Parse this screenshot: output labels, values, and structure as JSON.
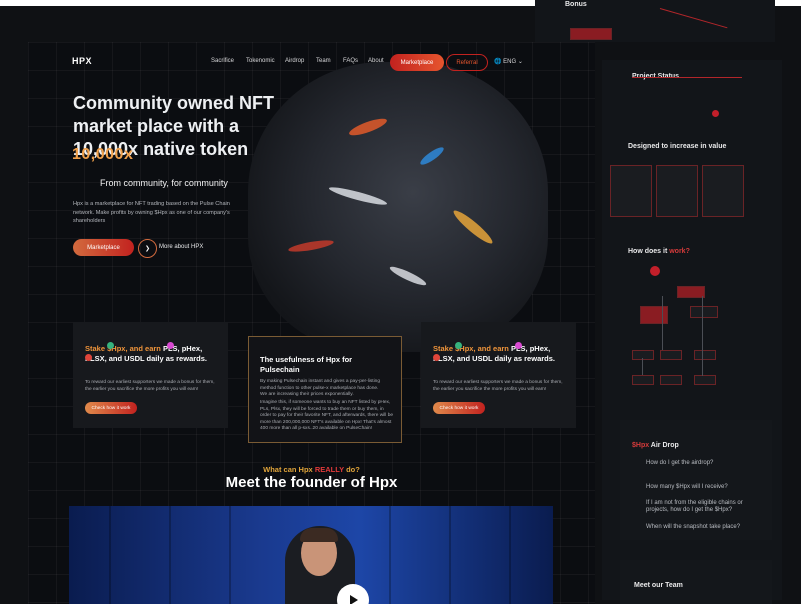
{
  "background_mockups": {
    "bonus_heading": "Bonus",
    "project_status": {
      "title": "Project Status"
    },
    "designed": {
      "title": "Designed to increase in value"
    },
    "how": {
      "title_a": "How does it ",
      "title_b": "work?"
    },
    "airdrop": {
      "title_a": "$Hpx",
      "title_b": " Air Drop",
      "q1": "How do I get the airdrop?",
      "q2": "How many $Hpx will I receive?",
      "q3": "If I am not from the eligible chains or projects, how do I get the $Hpx?",
      "q4": "When will the snapshot take place?"
    },
    "team": {
      "title": "Meet our Team"
    }
  },
  "nav": {
    "logo": "HPX",
    "links": [
      "Sacrifice",
      "Tokenomic",
      "Airdrop",
      "Team",
      "FAQs",
      "About"
    ],
    "marketplace_label": "Marketplace",
    "referral_label": "Referral",
    "language_label": "ENG",
    "globe_icon": "globe-icon",
    "chevron_icon": "chevron-down-icon"
  },
  "hero": {
    "title": "Community owned NFT market place with a 10,000x native token",
    "big_number": "10,000x",
    "subtitle": "From community, for community",
    "description": "Hpx is a marketplace for NFT trading based on the Pulse Chain network. Make profits by owning $Hpx as one of our company's shareholders",
    "cta_primary": "Marketplace",
    "cta_secondary": "More about HPX",
    "cta_secondary_icon": "arrow-right-icon"
  },
  "cards": {
    "left": {
      "title_a": "Stake ",
      "title_b": "$Hpx, and earn",
      "title_c": " PLS, pHex, PLSX, and USDL daily as rewards.",
      "text": "To reward our earliest supporters we made a bonus for them, the earlier you sacrifice the more profits you will earn!",
      "button": "Check how it work"
    },
    "middle": {
      "title": "The usefulness of Hpx for Pulsechain",
      "text1": "By making Pulsechain instant and gives a pay-per-listing method function to other pulse-x marketplace has done.",
      "text2": "We are increasing their prices exponentially.",
      "text3": "Imagine this, if someone wants to buy an NFT listed by pHex, PLs, Plsx, they will be forced to trade them or buy them, in order to pay for their favorite NFT, and afterwards, there will be more than 200,000,000 NFT's available on Hpx! That's almost 400 more than all p-sxs..20 available on PulseChain!"
    },
    "right": {
      "title_a": "Stake ",
      "title_b": "$Hpx, and earn",
      "title_c": " PLS, pHex, PLSX, and USDL daily as rewards.",
      "text": "To reward our earliest supporters we made a bonus for them, the earlier you sacrifice the more profits you will earn!",
      "button": "Check how it work"
    }
  },
  "founder": {
    "kicker_a": "What can Hpx ",
    "kicker_b": "REALLY",
    "kicker_c": " do?",
    "title": "Meet the founder of Hpx",
    "play_icon": "play-icon"
  },
  "colors": {
    "accent_red": "#c2221f",
    "accent_orange": "#f0953b",
    "background": "#0f1114"
  }
}
